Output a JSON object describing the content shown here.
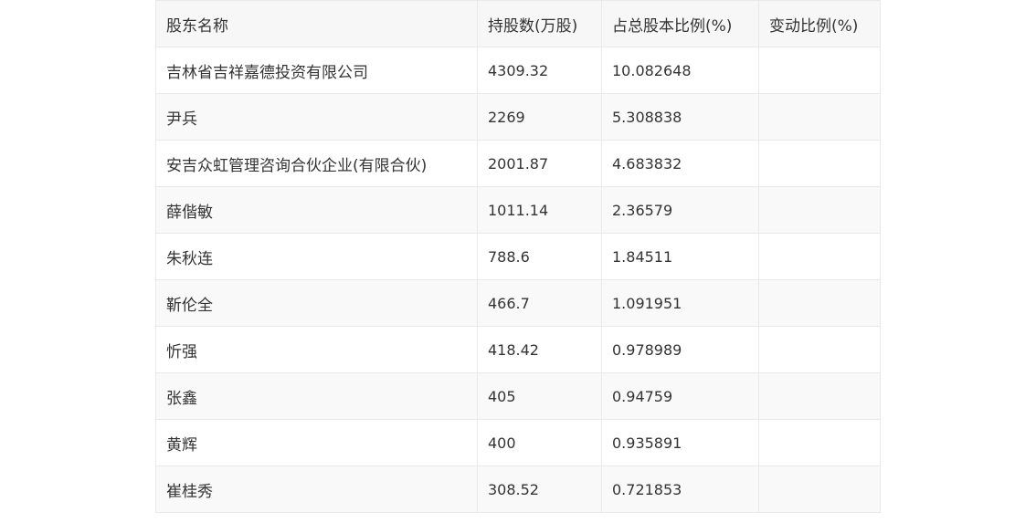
{
  "table": {
    "headers": [
      "股东名称",
      "持股数(万股)",
      "占总股本比例(%)",
      "变动比例(%)"
    ],
    "rows": [
      {
        "name": "吉林省吉祥嘉德投资有限公司",
        "shares": "4309.32",
        "ratio": "10.082648",
        "change": ""
      },
      {
        "name": "尹兵",
        "shares": "2269",
        "ratio": "5.308838",
        "change": ""
      },
      {
        "name": "安吉众虹管理咨询合伙企业(有限合伙)",
        "shares": "2001.87",
        "ratio": "4.683832",
        "change": ""
      },
      {
        "name": "薛偕敏",
        "shares": "1011.14",
        "ratio": "2.36579",
        "change": ""
      },
      {
        "name": "朱秋连",
        "shares": "788.6",
        "ratio": "1.84511",
        "change": ""
      },
      {
        "name": "靳伦全",
        "shares": "466.7",
        "ratio": "1.091951",
        "change": ""
      },
      {
        "name": "忻强",
        "shares": "418.42",
        "ratio": "0.978989",
        "change": ""
      },
      {
        "name": "张鑫",
        "shares": "405",
        "ratio": "0.94759",
        "change": ""
      },
      {
        "name": "黄辉",
        "shares": "400",
        "ratio": "0.935891",
        "change": ""
      },
      {
        "name": "崔桂秀",
        "shares": "308.52",
        "ratio": "0.721853",
        "change": ""
      }
    ]
  }
}
